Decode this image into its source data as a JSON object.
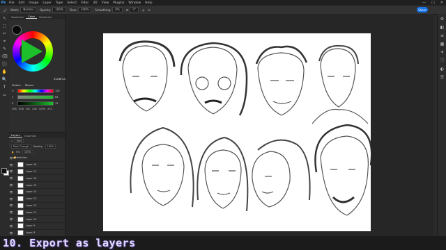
{
  "menubar": {
    "items": [
      "File",
      "Edit",
      "Image",
      "Layer",
      "Type",
      "Select",
      "Filter",
      "3D",
      "View",
      "Plugins",
      "Window",
      "Help"
    ],
    "window_controls": [
      "—",
      "□",
      "✕"
    ]
  },
  "options_bar": {
    "mode_label": "Mode:",
    "mode_value": "Normal",
    "opacity_label": "Opacity:",
    "opacity_value": "100%",
    "flow_label": "Flow:",
    "flow_value": "100%",
    "smoothing_label": "Smoothing:",
    "smoothing_value": "0%",
    "angle_value": "0°",
    "share_label": "Share"
  },
  "tools": [
    "↖",
    "⬚",
    "✂",
    "⌖",
    "✎",
    "⌫",
    "⬛",
    "✋",
    "🔍",
    "T",
    "▭"
  ],
  "right_icons": [
    "⚙",
    "◧",
    "≡",
    "▦",
    "✦",
    "ⓘ",
    "◐",
    "☰"
  ],
  "color_panel": {
    "tabs": [
      "Swatches",
      "Color",
      "Gradients"
    ],
    "active_tab": "Color",
    "hex": "#1DBF2A",
    "accent": "#1dbf2a"
  },
  "sliders": {
    "tabs": [
      "Sliders",
      "Mixers"
    ],
    "h_label": "H",
    "s_label": "S",
    "b_label": "B",
    "h_value": "125",
    "s_value": "85",
    "b_value": "75",
    "modes": [
      "HSB",
      "RGB",
      "HSL",
      "LAB",
      "CMYK",
      "XYZ"
    ]
  },
  "layers_panel": {
    "tabs": [
      "Layers",
      "Channels"
    ],
    "active_tab": "Layers",
    "kind_label": "Kind",
    "blend_mode": "Pass Through",
    "opacity_label": "Opacity:",
    "opacity_value": "100%",
    "fill_label": "Fill:",
    "fill_value": "100%",
    "group_name": "sketches",
    "layers": [
      "Layer 18",
      "Layer 17",
      "Layer 16",
      "Layer 15",
      "Layer 14",
      "Layer 13",
      "Layer 12",
      "Layer 11",
      "Layer 10",
      "Layer 9",
      "Layer 8"
    ]
  },
  "caption": {
    "text": "10. Export as layers"
  }
}
